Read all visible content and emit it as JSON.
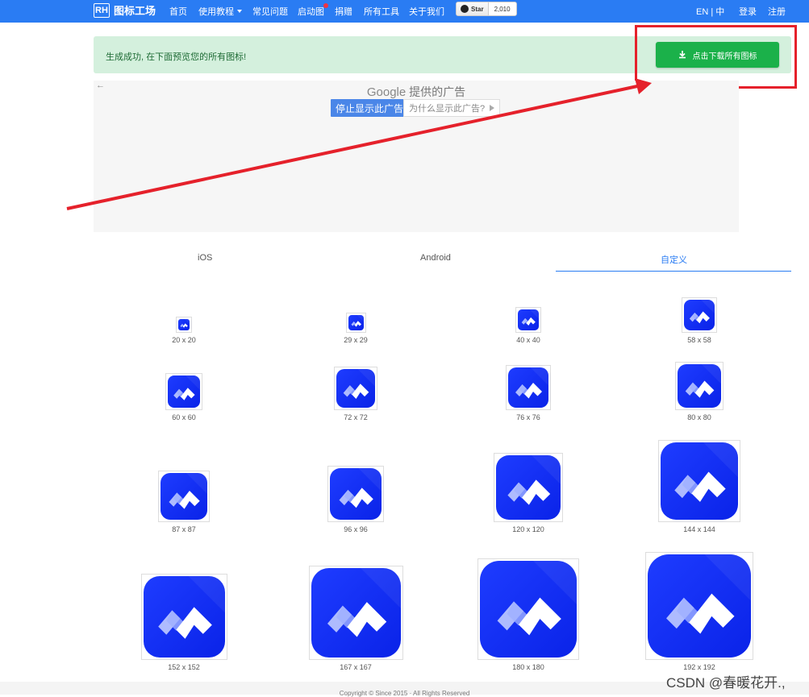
{
  "navbar": {
    "brand_box": "RH",
    "brand_name": "图标工场",
    "items": [
      "首页",
      "使用教程",
      "常见问题",
      "启动图",
      "捐赠",
      "所有工具",
      "关于我们"
    ],
    "github_star": "Star",
    "github_count": "2,010",
    "lang": "EN | 中",
    "login": "登录",
    "register": "注册"
  },
  "alert": {
    "message": "生成成功, 在下面预览您的所有图标!",
    "download_label": "点击下载所有图标"
  },
  "ad": {
    "back": "←",
    "google": "Google",
    "provided": "提供的广告",
    "stop": "停止显示此广告",
    "why": "为什么显示此广告?"
  },
  "tabs": [
    {
      "label": "iOS",
      "active": false
    },
    {
      "label": "Android",
      "active": false
    },
    {
      "label": "自定义",
      "active": true
    }
  ],
  "icons": [
    "20 x 20",
    "29 x 29",
    "40 x 40",
    "58 x 58",
    "60 x 60",
    "72 x 72",
    "76 x 76",
    "80 x 80",
    "87 x 87",
    "96 x 96",
    "120 x 120",
    "144 x 144",
    "152 x 152",
    "167 x 167",
    "180 x 180",
    "192 x 192"
  ],
  "footer": {
    "copyright": "Copyright © Since 2015 · All Rights Reserved"
  },
  "watermark": "CSDN @春暖花开.,",
  "colors": {
    "navbar": "#2a7cf3",
    "alert_bg": "#d4f0dd",
    "download_btn": "#1bb14a",
    "annotation_red": "#e5212b",
    "icon_blue": "#1e3cff"
  }
}
